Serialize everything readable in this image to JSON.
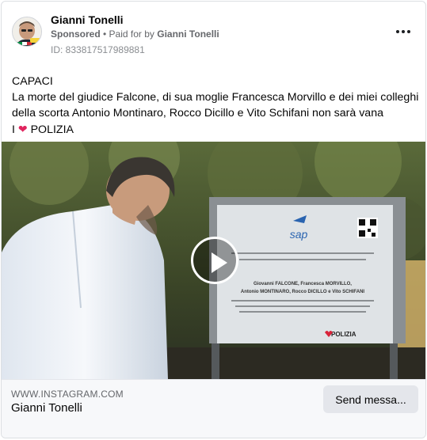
{
  "post": {
    "page_name": "Gianni Tonelli",
    "sponsored_label": "Sponsored",
    "separator": " • ",
    "paid_for_prefix": "Paid for by ",
    "paid_for_name": "Gianni Tonelli",
    "ad_id": "ID: 833817517989881",
    "more_icon": "more-horizontal-icon",
    "text_lines": [
      "CAPACI",
      "La morte del giudice Falcone, di sua moglie Francesca Morvillo e dei miei colleghi",
      "della scorta Antonio Montinaro, Rocco Dicillo e Vito Schifani non sarà vana"
    ],
    "last_line_prefix": "I ",
    "last_line_heart": "❤",
    "last_line_suffix": " POLIZIA"
  },
  "media": {
    "type": "video",
    "play_icon": "play-icon",
    "plaque": {
      "logo_text": "sap",
      "lines": [
        "Giovanni FALCONE, Francesca MORVILLO,",
        "Antonio MONTINARO, Rocco DICILLO e Vito SCHIFANI"
      ],
      "footer_brand": "POLIZIA"
    }
  },
  "link": {
    "domain": "WWW.INSTAGRAM.COM",
    "title": "Gianni Tonelli",
    "cta_label": "Send messa..."
  },
  "colors": {
    "heart": "#e0245e",
    "cta_bg": "#e4e6eb",
    "footer_bg": "#f7f8fa",
    "secondary_text": "#65676b"
  }
}
